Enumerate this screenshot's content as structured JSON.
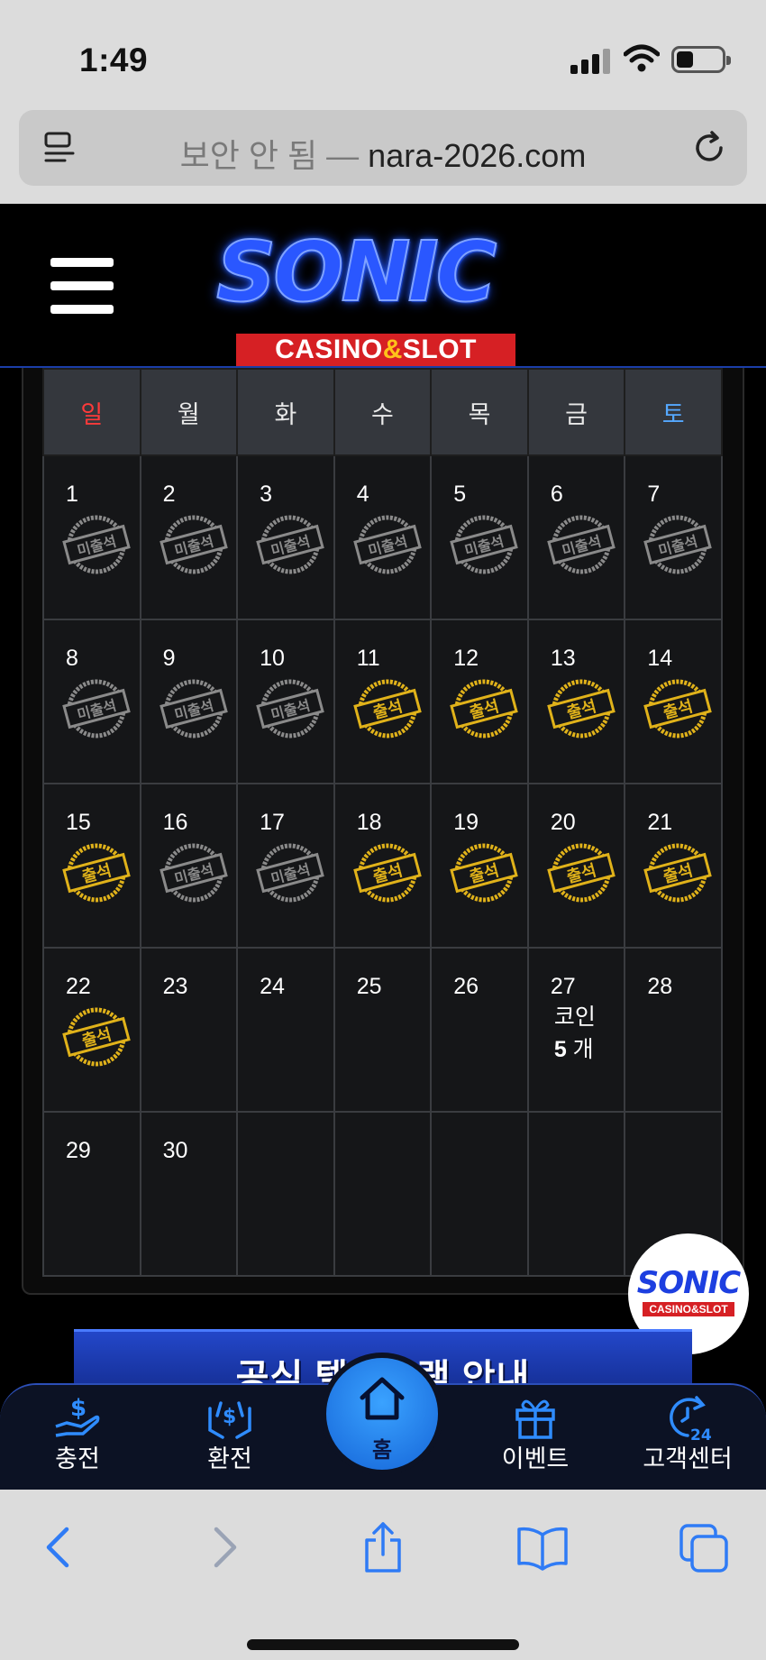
{
  "status_bar": {
    "time": "1:49"
  },
  "address_bar": {
    "security_label": "보안 안 됨",
    "separator": " — ",
    "domain": "nara-2026.com"
  },
  "site": {
    "logo_title": "SONIC",
    "logo_sub_left": "CASINO",
    "logo_sub_amp": "&",
    "logo_sub_right": "SLOT",
    "brand_colors": {
      "logo_blue": "#2a57ff",
      "logo_red": "#d62024",
      "attended_gold": "#e0b21a",
      "absent_gray": "#8a8a8a"
    }
  },
  "calendar": {
    "weekdays": [
      "일",
      "월",
      "화",
      "수",
      "목",
      "금",
      "토"
    ],
    "stamp_labels": {
      "attended": "출석",
      "absent": "미출석"
    },
    "weeks": [
      [
        {
          "day": "1",
          "status": "absent"
        },
        {
          "day": "2",
          "status": "absent"
        },
        {
          "day": "3",
          "status": "absent"
        },
        {
          "day": "4",
          "status": "absent"
        },
        {
          "day": "5",
          "status": "absent"
        },
        {
          "day": "6",
          "status": "absent"
        },
        {
          "day": "7",
          "status": "absent"
        }
      ],
      [
        {
          "day": "8",
          "status": "absent"
        },
        {
          "day": "9",
          "status": "absent"
        },
        {
          "day": "10",
          "status": "absent"
        },
        {
          "day": "11",
          "status": "attended"
        },
        {
          "day": "12",
          "status": "attended"
        },
        {
          "day": "13",
          "status": "attended"
        },
        {
          "day": "14",
          "status": "attended"
        }
      ],
      [
        {
          "day": "15",
          "status": "attended"
        },
        {
          "day": "16",
          "status": "absent"
        },
        {
          "day": "17",
          "status": "absent"
        },
        {
          "day": "18",
          "status": "attended"
        },
        {
          "day": "19",
          "status": "attended"
        },
        {
          "day": "20",
          "status": "attended"
        },
        {
          "day": "21",
          "status": "attended"
        }
      ],
      [
        {
          "day": "22",
          "status": "attended"
        },
        {
          "day": "23",
          "status": "none"
        },
        {
          "day": "24",
          "status": "none"
        },
        {
          "day": "25",
          "status": "none"
        },
        {
          "day": "26",
          "status": "none"
        },
        {
          "day": "27",
          "status": "coin",
          "coin_label": "코인",
          "coin_count": "5",
          "coin_unit": "개"
        },
        {
          "day": "28",
          "status": "none"
        }
      ],
      [
        {
          "day": "29",
          "status": "none"
        },
        {
          "day": "30",
          "status": "none"
        },
        {
          "day": "",
          "status": "none"
        },
        {
          "day": "",
          "status": "none"
        },
        {
          "day": "",
          "status": "none"
        },
        {
          "day": "",
          "status": "none"
        },
        {
          "day": "",
          "status": "none"
        }
      ]
    ]
  },
  "floating_badge": {
    "title": "SONIC",
    "sub": "CASINO&SLOT"
  },
  "banner": {
    "text": "공식 텔레그램 안내"
  },
  "bottom_nav": {
    "items": [
      {
        "label": "충전",
        "icon": "deposit-icon"
      },
      {
        "label": "환전",
        "icon": "exchange-icon"
      },
      {
        "label": "홈",
        "icon": "home-icon"
      },
      {
        "label": "이벤트",
        "icon": "gift-icon"
      },
      {
        "label": "고객센터",
        "icon": "support-24-icon"
      }
    ]
  }
}
